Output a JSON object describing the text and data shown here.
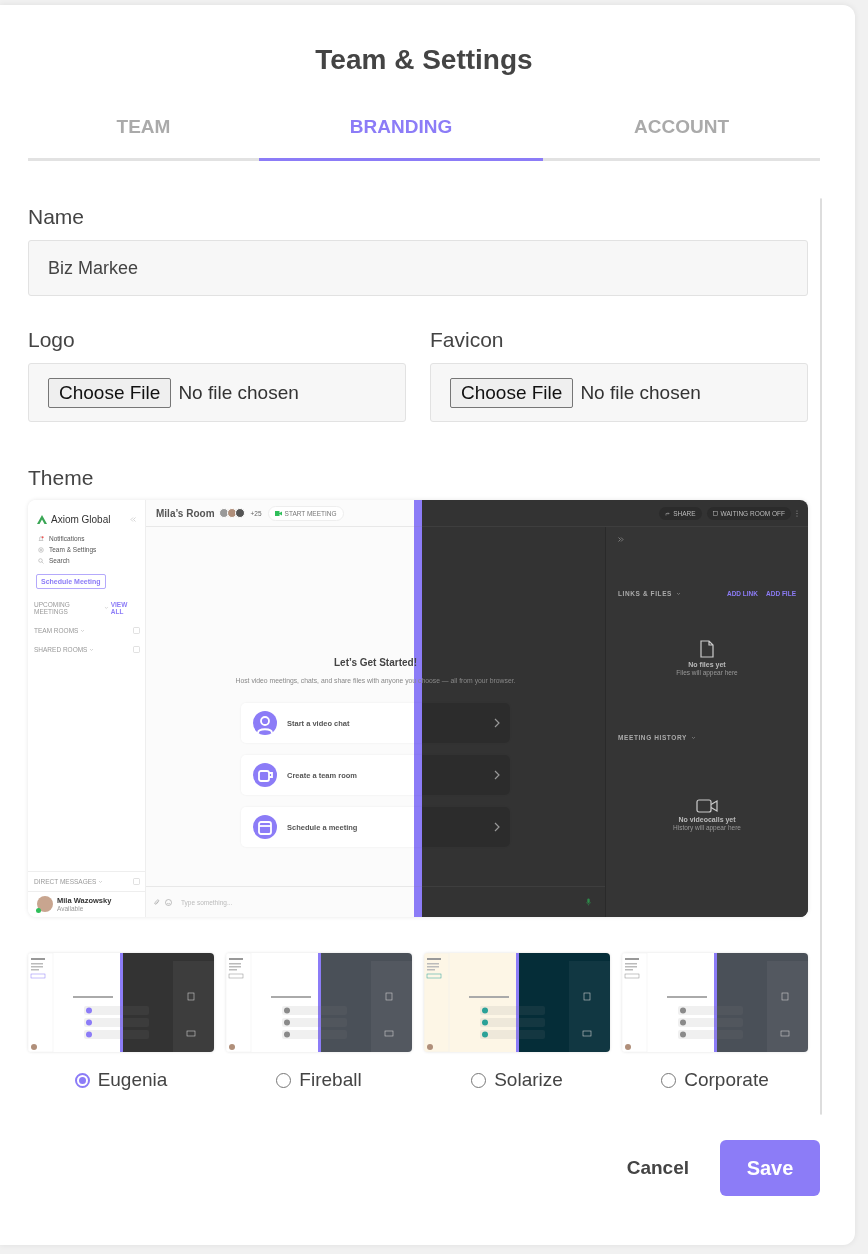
{
  "dialog": {
    "title": "Team & Settings"
  },
  "tabs": [
    {
      "label": "TEAM",
      "selected": false
    },
    {
      "label": "BRANDING",
      "selected": true
    },
    {
      "label": "ACCOUNT",
      "selected": false
    }
  ],
  "name_field": {
    "label": "Name",
    "value": "Biz Markee"
  },
  "file_fields": [
    {
      "label": "Logo",
      "button": "Choose File",
      "status": "No file chosen"
    },
    {
      "label": "Favicon",
      "button": "Choose File",
      "status": "No file chosen"
    }
  ],
  "theme": {
    "label": "Theme",
    "preview": {
      "brand": "Axiom Global",
      "nav": [
        "Notifications",
        "Team & Settings",
        "Search"
      ],
      "schedule_button": "Schedule Meeting",
      "sections": [
        {
          "label": "UPCOMING MEETINGS",
          "link": "VIEW ALL"
        },
        {
          "label": "TEAM ROOMS"
        },
        {
          "label": "SHARED ROOMS"
        }
      ],
      "direct_messages": "DIRECT MESSAGES",
      "user": {
        "name": "Mila Wazowsky",
        "status": "Available"
      },
      "room_title": "Mila’s Room",
      "participants_more": "+25",
      "start_meeting": "START MEETING",
      "share": "SHARE",
      "waiting_room": "WAITING ROOM OFF",
      "heading": "Let’s Get Started!",
      "description": "Host video meetings, chats, and share files with anyone you choose — all from your browser.",
      "actions": [
        "Start a video chat",
        "Create a team room",
        "Schedule a meeting"
      ],
      "message_placeholder": "Type something...",
      "links_files": {
        "title": "LINKS & FILES",
        "links": [
          "ADD LINK",
          "ADD FILE"
        ],
        "empty_title": "No files yet",
        "empty_text": "Files will appear here"
      },
      "meeting_history": {
        "title": "MEETING HISTORY",
        "empty_title": "No videocalls yet",
        "empty_text": "History will appear here"
      }
    },
    "options": [
      {
        "name": "Eugenia",
        "selected": true,
        "kind": "dark",
        "color": "#333333"
      },
      {
        "name": "Fireball",
        "selected": false,
        "kind": "slate",
        "color": "#4a5058"
      },
      {
        "name": "Solarize",
        "selected": false,
        "kind": "solarized",
        "color": "#052d38"
      },
      {
        "name": "Corporate",
        "selected": false,
        "kind": "slate",
        "color": "#4a5058"
      }
    ]
  },
  "footer": {
    "cancel": "Cancel",
    "save": "Save"
  }
}
